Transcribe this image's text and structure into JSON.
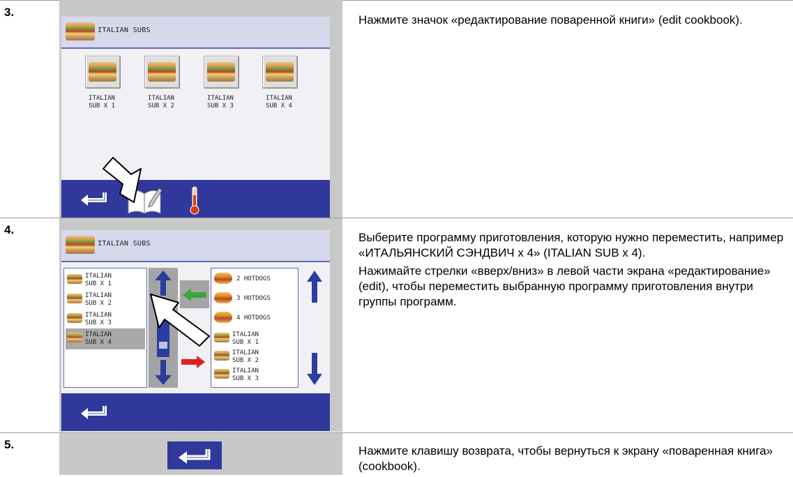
{
  "steps": [
    {
      "number": "3.",
      "description": [
        "Нажмите значок «редактирование поваренной книги» (edit cookbook)."
      ],
      "screen": {
        "title": "ITALIAN SUBS",
        "items": [
          {
            "line1": "ITALIAN",
            "line2": "SUB X 1"
          },
          {
            "line1": "ITALIAN",
            "line2": "SUB X 2"
          },
          {
            "line1": "ITALIAN",
            "line2": "SUB X 3"
          },
          {
            "line1": "ITALIAN",
            "line2": "SUB X 4"
          }
        ],
        "icons": [
          "back-arrow-icon",
          "edit-cookbook-icon",
          "thermometer-icon"
        ]
      }
    },
    {
      "number": "4.",
      "description": [
        "Выберите программу приготовления, которую нужно переместить, например «ИТАЛЬЯНСКИЙ СЭНДВИЧ х 4» (ITALIAN SUB х 4).",
        "Нажимайте стрелки «вверх/вниз» в левой части экрана «редактирование» (edit), чтобы переместить выбранную программу приготовления внутри группы программ."
      ],
      "screen": {
        "title": "ITALIAN SUBS",
        "left_list": [
          {
            "line1": "ITALIAN",
            "line2": "SUB X 1"
          },
          {
            "line1": "ITALIAN",
            "line2": "SUB X 2"
          },
          {
            "line1": "ITALIAN",
            "line2": "SUB X 3"
          },
          {
            "line1": "ITALIAN",
            "line2": "SUB X 4"
          }
        ],
        "right_list": [
          {
            "line1": "2 HOTDOGS",
            "line2": ""
          },
          {
            "line1": "3 HOTDOGS",
            "line2": ""
          },
          {
            "line1": "4 HOTDOGS",
            "line2": ""
          },
          {
            "line1": "ITALIAN",
            "line2": "SUB X 1"
          },
          {
            "line1": "ITALIAN",
            "line2": "SUB X 2"
          },
          {
            "line1": "ITALIAN",
            "line2": "SUB X 3"
          }
        ]
      }
    },
    {
      "number": "5.",
      "description": [
        "Нажмите клавишу возврата, чтобы вернуться к экрану «поваренная книга» (cookbook)."
      ]
    }
  ],
  "colors": {
    "bar_blue": "#30399b",
    "arrow_blue": "#2a3da0",
    "green_arrow": "#3aa63a",
    "red_arrow": "#e02020"
  }
}
